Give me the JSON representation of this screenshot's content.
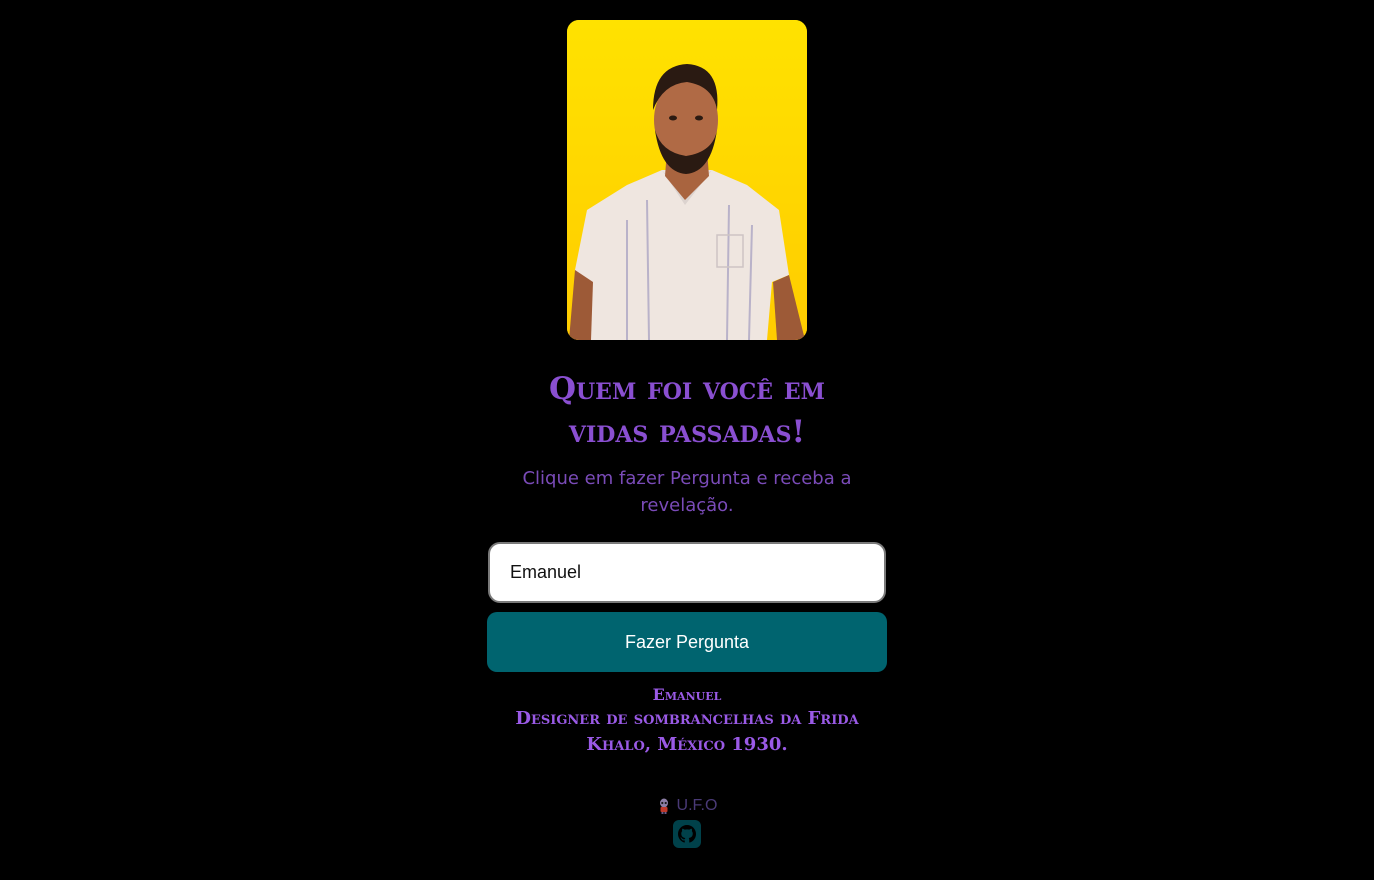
{
  "hero": {
    "headline_line1": "Quem foi você em",
    "headline_line2": "vidas passadas!",
    "subtitle_line1": "Clique em fazer Pergunta e receba a",
    "subtitle_line2": "revelação."
  },
  "form": {
    "name_value": "Emanuel",
    "ask_button_label": "Fazer Pergunta"
  },
  "answer": {
    "name": "Emanuel",
    "line1": "Designer de sombrancelhas da Frida",
    "line2": "Khalo, México 1930."
  },
  "footer": {
    "brand": "U.F.O",
    "brand_icon": "alien-icon",
    "link_icon": "github-icon"
  },
  "colors": {
    "background": "#000000",
    "accent_purple": "#8a4fd1",
    "button_teal": "#00646f"
  }
}
